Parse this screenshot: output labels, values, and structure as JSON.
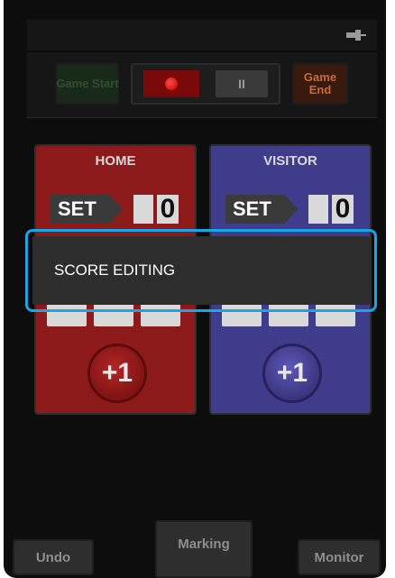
{
  "top_panel": {
    "game_start_label": "Game Start",
    "game_end_label": "Game End",
    "pause_label": "II",
    "status_icon": "plug-icon"
  },
  "teams": {
    "home": {
      "name": "HOME",
      "set_label": "SET",
      "set_value": "0",
      "accent_color": "#8c1a1a"
    },
    "visitor": {
      "name": "VISITOR",
      "set_label": "SET",
      "set_value": "0",
      "accent_color": "#3f3c8c"
    }
  },
  "plus_label": "+1",
  "popup": {
    "label": "SCORE EDITING",
    "highlight_color": "#19a6e6"
  },
  "bottom_bar": {
    "undo_label": "Undo",
    "marking_label": "Marking",
    "monitor_label": "Monitor"
  }
}
